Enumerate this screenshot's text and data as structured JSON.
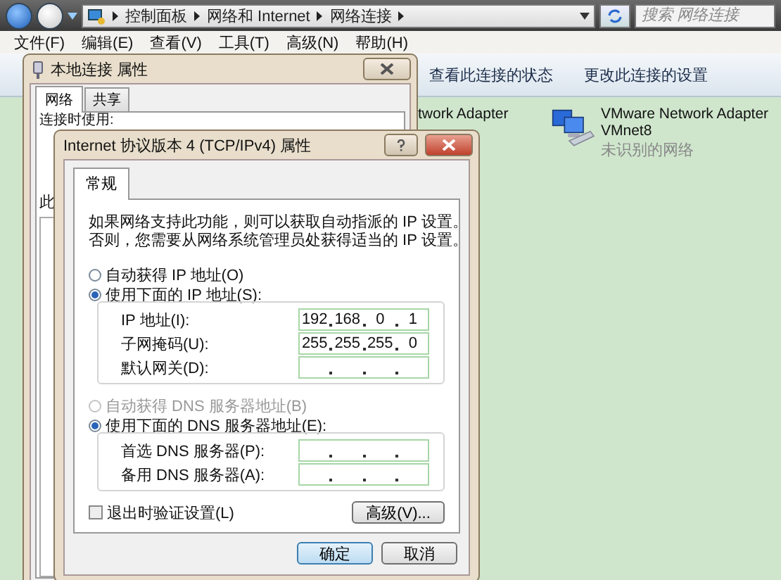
{
  "address_bar": {
    "breadcrumbs": [
      "控制面板",
      "网络和 Internet",
      "网络连接"
    ],
    "search": {
      "placeholder": "搜索 网络连接"
    }
  },
  "menu_bar": [
    "文件(F)",
    "编辑(E)",
    "查看(V)",
    "工具(T)",
    "高级(N)",
    "帮助(H)"
  ],
  "toolbar": [
    "查看此连接的状态",
    "更改此连接的设置"
  ],
  "adapters": [
    {
      "name": "twork Adapter"
    },
    {
      "name": "VMware Network Adapter",
      "device": "VMnet8",
      "status": "未识别的网络"
    }
  ],
  "connection_dialog": {
    "title": "本地连接 属性",
    "tabs": [
      {
        "label": "网络",
        "selected": true
      },
      {
        "label": "共享",
        "selected": false
      }
    ],
    "connect_using_label": "连接时使用:",
    "items_label": "此"
  },
  "ipv4_dialog": {
    "title": "Internet 协议版本 4 (TCP/IPv4) 属性",
    "tabs": [
      {
        "label": "常规",
        "selected": true
      }
    ],
    "description": "如果网络支持此功能，则可以获取自动指派的 IP 设置。否则，您需要从网络系统管理员处获得适当的 IP 设置。",
    "ip_mode": [
      {
        "label": "自动获得 IP 地址(O)",
        "selected": false,
        "disabled": false
      },
      {
        "label": "使用下面的 IP 地址(S):",
        "selected": true,
        "disabled": false
      }
    ],
    "ip_fields": [
      {
        "label": "IP 地址(I):",
        "octets": [
          "192",
          "168",
          "0",
          "1"
        ]
      },
      {
        "label": "子网掩码(U):",
        "octets": [
          "255",
          "255",
          "255",
          "0"
        ]
      },
      {
        "label": "默认网关(D):"
      }
    ],
    "dns_mode": [
      {
        "label": "自动获得 DNS 服务器地址(B)",
        "selected": false,
        "disabled": true
      },
      {
        "label": "使用下面的 DNS 服务器地址(E):",
        "selected": true,
        "disabled": false
      }
    ],
    "dns_fields": [
      {
        "label": "首选 DNS 服务器(P):"
      },
      {
        "label": "备用 DNS 服务器(A):"
      }
    ],
    "validate": {
      "label": "退出时验证设置(L)",
      "checked": false
    },
    "advanced_button": "高级(V)...",
    "buttons": [
      "确定",
      "取消"
    ]
  }
}
